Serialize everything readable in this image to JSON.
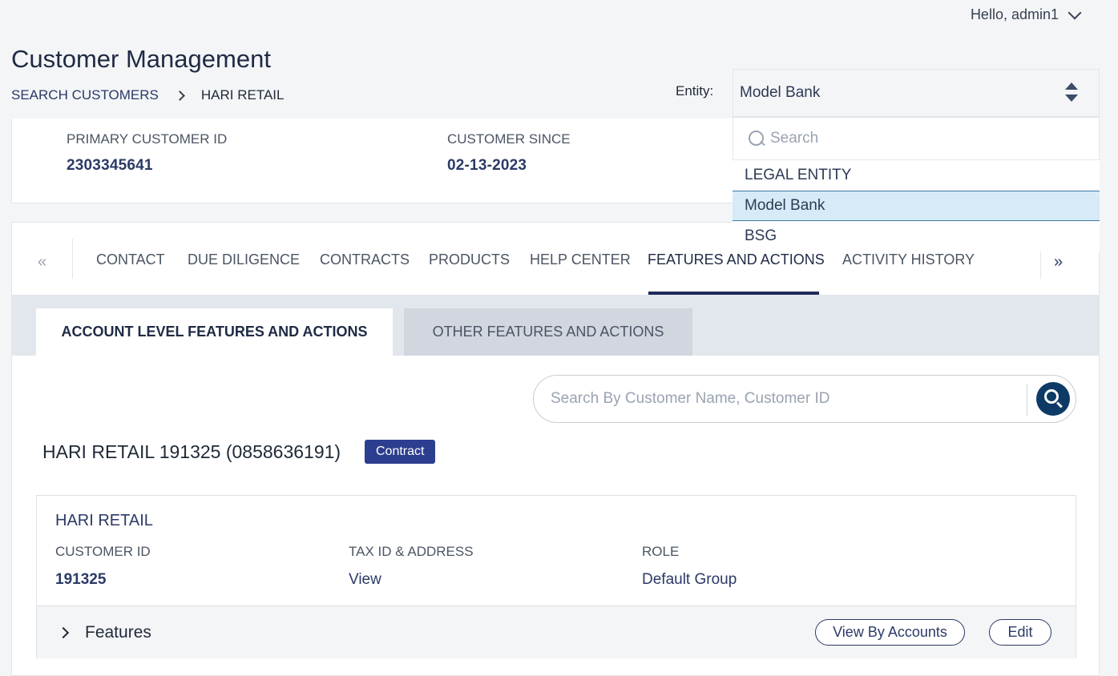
{
  "header": {
    "greeting": "Hello, admin1",
    "page_title": "Customer Management",
    "breadcrumb": {
      "link": "SEARCH CUSTOMERS",
      "current": "HARI RETAIL"
    }
  },
  "entity": {
    "label": "Entity:",
    "selected": "Model Bank",
    "search_placeholder": "Search",
    "options": [
      "LEGAL ENTITY",
      "Model Bank",
      "BSG"
    ],
    "selected_index": 1
  },
  "info": {
    "primary_id_label": "PRIMARY CUSTOMER ID",
    "primary_id_value": "2303345641",
    "since_label": "CUSTOMER SINCE",
    "since_value": "02-13-2023"
  },
  "tabs": {
    "prev": "«",
    "next": "»",
    "items": [
      "CONTACT",
      "DUE DILIGENCE",
      "CONTRACTS",
      "PRODUCTS",
      "HELP CENTER",
      "FEATURES AND ACTIONS",
      "ACTIVITY HISTORY"
    ],
    "active": "FEATURES AND ACTIONS"
  },
  "subtabs": {
    "account": "ACCOUNT LEVEL FEATURES AND ACTIONS",
    "other": "OTHER FEATURES AND ACTIONS"
  },
  "search": {
    "placeholder": "Search By Customer Name, Customer ID"
  },
  "customer": {
    "heading": "HARI RETAIL 191325 (0858636191)",
    "badge": "Contract",
    "name": "HARI RETAIL",
    "id_label": "CUSTOMER ID",
    "id_value": "191325",
    "tax_label": "TAX ID & ADDRESS",
    "tax_value": "View",
    "role_label": "ROLE",
    "role_value": "Default Group"
  },
  "features": {
    "label": "Features",
    "view_by_accounts": "View By Accounts",
    "edit": "Edit"
  },
  "colors": {
    "primary": "#2b3a67",
    "badge": "#2c3e8f",
    "search_button": "#0d3b66",
    "selected_option": "#d6ebf7"
  }
}
